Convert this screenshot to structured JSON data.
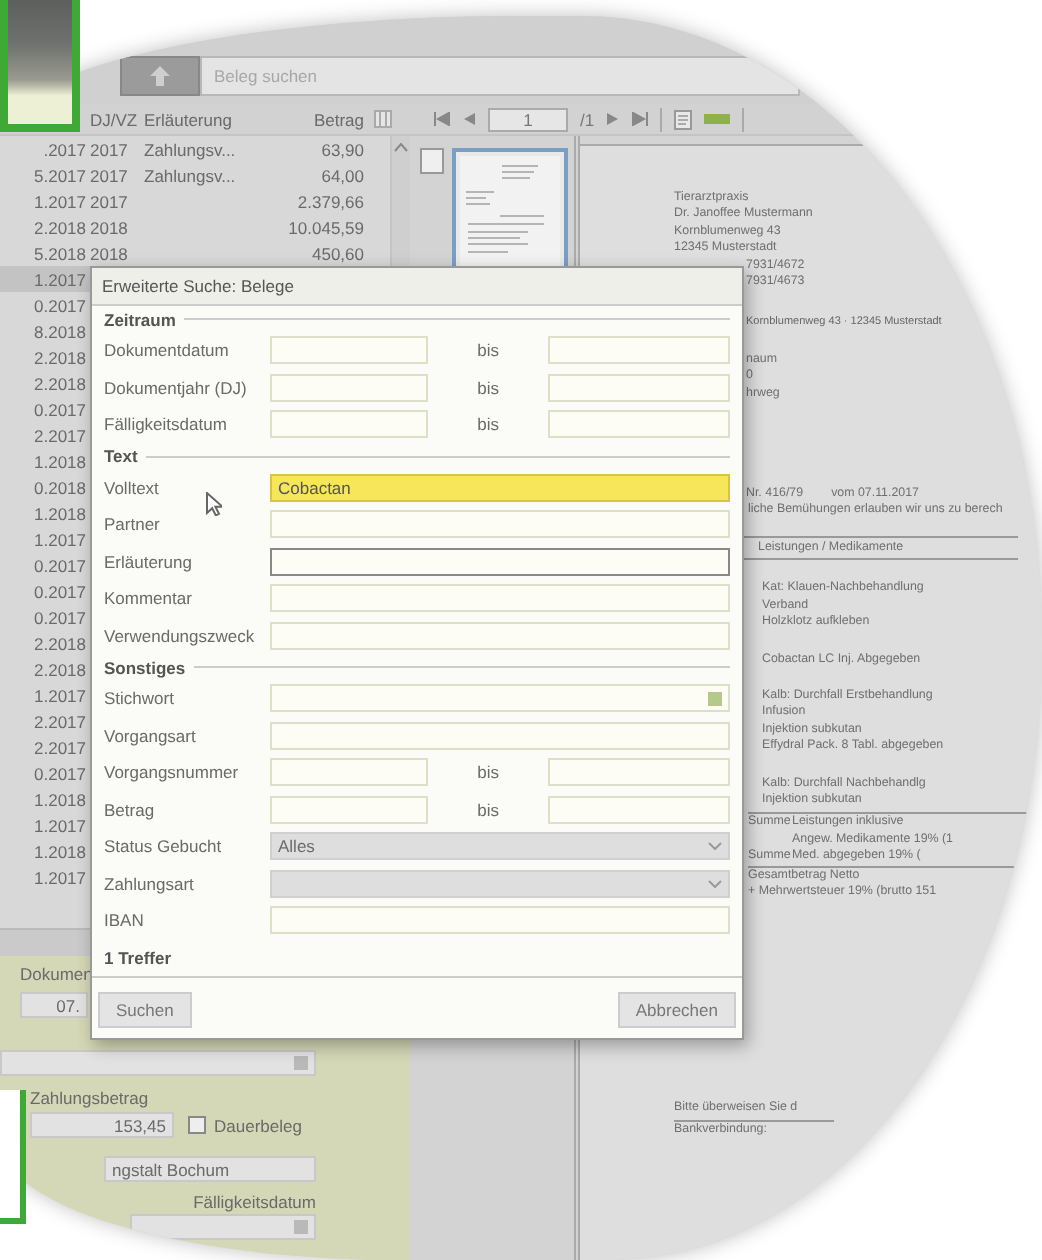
{
  "search": {
    "placeholder": "Beleg suchen"
  },
  "list": {
    "columns": [
      "DJ/VZ",
      "Erläuterung",
      "Betrag"
    ],
    "rows": [
      {
        "date": ".2017",
        "year": "2017",
        "text": "Zahlungsv...",
        "amount": "63,90",
        "selected": false
      },
      {
        "date": "5.2017",
        "year": "2017",
        "text": "Zahlungsv...",
        "amount": "64,00",
        "selected": false
      },
      {
        "date": "1.2017",
        "year": "2017",
        "amount": "2.379,66",
        "selected": false
      },
      {
        "date": "2.2018",
        "year": "2018",
        "amount": "10.045,59",
        "selected": false
      },
      {
        "date": "5.2018",
        "year": "2018",
        "amount": "450,60",
        "selected": false
      },
      {
        "date": "1.2017",
        "selected": true
      },
      {
        "date": "0.2017",
        "selected": false
      },
      {
        "date": "8.2018",
        "selected": false
      },
      {
        "date": "2.2018",
        "selected": false
      },
      {
        "date": "2.2018",
        "selected": false
      },
      {
        "date": "0.2017",
        "selected": false
      },
      {
        "date": "2.2017",
        "selected": false
      },
      {
        "date": "1.2018",
        "selected": false
      },
      {
        "date": "0.2018",
        "selected": false
      },
      {
        "date": "1.2018",
        "selected": false
      },
      {
        "date": "1.2017",
        "selected": false
      },
      {
        "date": "0.2017",
        "selected": false
      },
      {
        "date": "0.2017",
        "selected": false
      },
      {
        "date": "0.2017",
        "selected": false
      },
      {
        "date": "2.2018",
        "selected": false
      },
      {
        "date": "2.2018",
        "selected": false
      },
      {
        "date": "1.2017",
        "selected": false
      },
      {
        "date": "2.2017",
        "selected": false
      },
      {
        "date": "2.2017",
        "selected": false
      },
      {
        "date": "0.2017",
        "selected": false
      },
      {
        "date": "1.2018",
        "selected": false
      },
      {
        "date": "1.2017",
        "selected": false
      },
      {
        "date": "1.2018",
        "selected": false
      },
      {
        "date": "1.2017",
        "selected": false
      }
    ]
  },
  "pager": {
    "page": "1",
    "total": "/1"
  },
  "detail": {
    "document_label": "Dokumen",
    "document_value": "07.",
    "payment_label": "Zahlungsbetrag",
    "payment_value": "153,45",
    "standing_order": {
      "label": "Dauerbeleg",
      "checked": false
    },
    "bank_value": "ngstalt Bochum",
    "due_label": "Fälligkeitsdatum"
  },
  "document": {
    "sender": [
      "Tierarztpraxis",
      "Dr. Janoffee Mustermann",
      "Kornblumenweg 43",
      "12345 Musterstadt"
    ],
    "phones": [
      "7931/4672",
      "7931/4673"
    ],
    "return_address": "Kornblumenweg 43 · 12345 Musterstadt",
    "recipient": [
      "naum",
      "0",
      "hrweg"
    ],
    "invoice_number": "Nr. 416/79",
    "invoice_date": "vom 07.11.2017",
    "intro": "liche Bemühungen erlauben wir uns zu berech",
    "table_heading": "Leistungen / Medikamente",
    "items": [
      [
        "Kat: Klauen-Nachbehandlung",
        "Verband",
        "Holzklotz aufkleben"
      ],
      [
        "Cobactan LC Inj. Abgegeben"
      ],
      [
        "Kalb: Durchfall Erstbehandlung",
        "Infusion",
        "Injektion subkutan",
        "Effydral Pack. 8 Tabl. abgegeben"
      ],
      [
        "Kalb: Durchfall Nachbehandlg",
        "Injektion subkutan"
      ]
    ],
    "totals": [
      {
        "label": "Summe",
        "text": "Leistungen inklusive"
      },
      {
        "text": "Angew. Medikamente 19% (1"
      },
      {
        "label": "Summe",
        "text": "Med. abgegeben   19% ("
      }
    ],
    "grand_totals": [
      "Gesamtbetrag Netto",
      "+ Mehrwertsteuer 19% (brutto 151"
    ],
    "footer": [
      "Bitte überweisen Sie d",
      "Bankverbindung:"
    ]
  },
  "dialog": {
    "title": "Erweiterte Suche: Belege",
    "sections": [
      {
        "title": "Zeitraum",
        "fields": [
          {
            "label": "Dokumentdatum",
            "kind": "range",
            "separator": "bis",
            "highlighted": false,
            "focused": false
          },
          {
            "label": "Dokumentjahr (DJ)",
            "kind": "range",
            "separator": "bis",
            "highlighted": false,
            "focused": false
          },
          {
            "label": "Fälligkeitsdatum",
            "kind": "range",
            "separator": "bis",
            "highlighted": false,
            "focused": false
          }
        ]
      },
      {
        "title": "Text",
        "fields": [
          {
            "label": "Volltext",
            "kind": "text",
            "value": "Cobactan",
            "highlighted": true,
            "focused": false
          },
          {
            "label": "Partner",
            "kind": "text",
            "highlighted": false,
            "focused": false
          },
          {
            "label": "Erläuterung",
            "kind": "text",
            "highlighted": false,
            "focused": true
          },
          {
            "label": "Kommentar",
            "kind": "text",
            "highlighted": false,
            "focused": false
          },
          {
            "label": "Verwendungszweck",
            "kind": "text",
            "highlighted": false,
            "focused": false
          }
        ]
      },
      {
        "title": "Sonstiges",
        "fields": [
          {
            "label": "Stichwort",
            "kind": "lookup",
            "highlighted": false,
            "focused": false
          },
          {
            "label": "Vorgangsart",
            "kind": "text",
            "highlighted": false,
            "focused": false
          },
          {
            "label": "Vorgangsnummer",
            "kind": "range",
            "separator": "bis",
            "highlighted": false,
            "focused": false
          },
          {
            "label": "Betrag",
            "kind": "range",
            "separator": "bis",
            "highlighted": false,
            "focused": false
          },
          {
            "label": "Status Gebucht",
            "kind": "select",
            "value": "Alles",
            "highlighted": false,
            "focused": false
          },
          {
            "label": "Zahlungsart",
            "kind": "select",
            "highlighted": false,
            "focused": false
          },
          {
            "label": "IBAN",
            "kind": "text",
            "highlighted": false,
            "focused": false
          }
        ]
      }
    ],
    "result": "1 Treffer",
    "buttons": [
      "Suchen",
      "Abbrechen"
    ]
  }
}
